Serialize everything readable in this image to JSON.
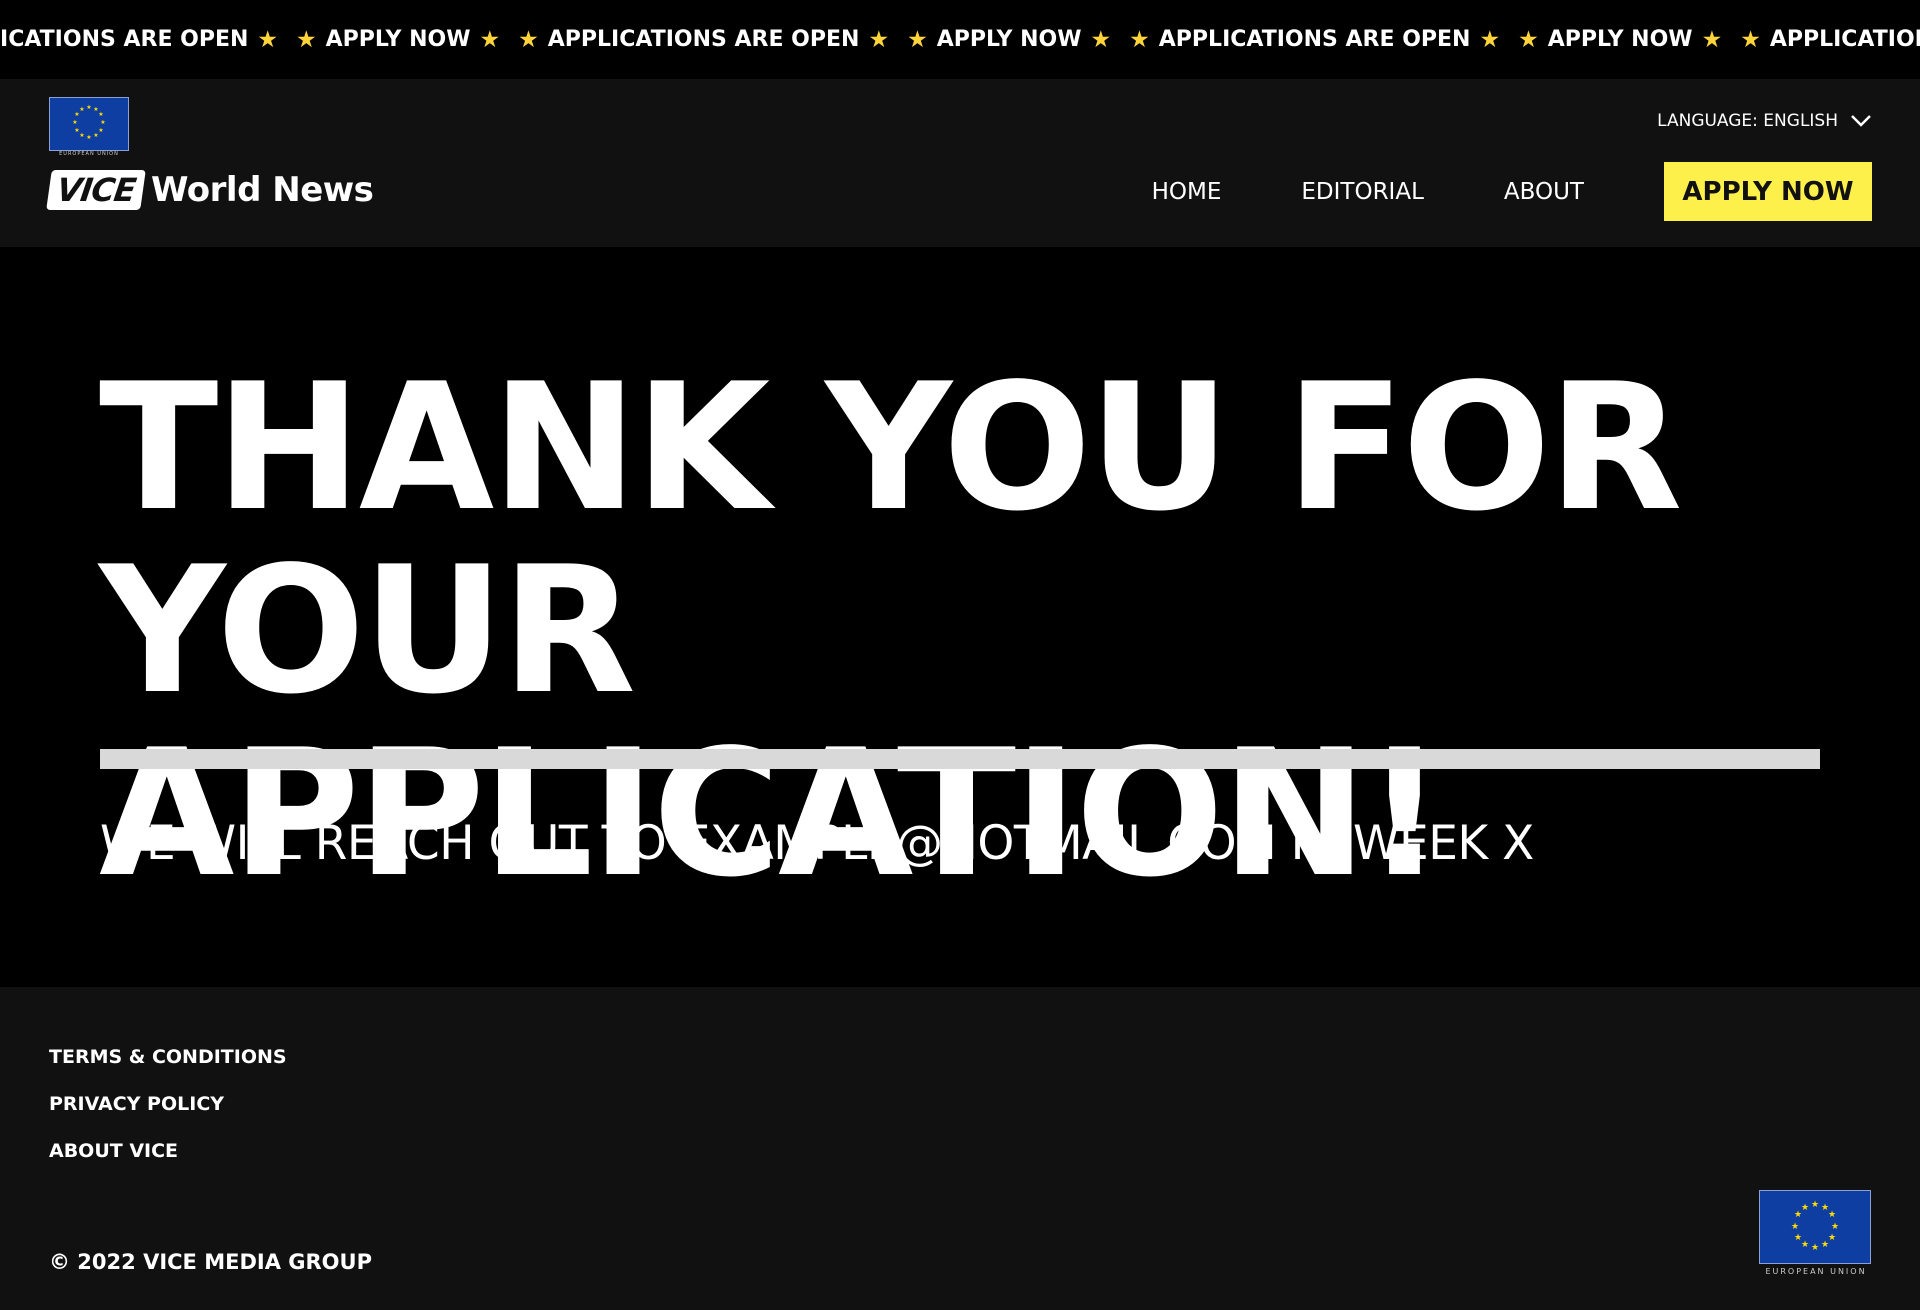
{
  "ticker": {
    "items": [
      {
        "text": "LICATIONS ARE OPEN"
      },
      {
        "text": "APPLY NOW"
      },
      {
        "text": "APPLICATIONS ARE OPEN"
      },
      {
        "text": "APPLY NOW"
      },
      {
        "text": "APPLICATIONS ARE OPEN"
      },
      {
        "text": "APPLY NOW"
      },
      {
        "text": "APPLICATIONS ARE OPEN"
      }
    ],
    "star_color": "#ffd43b"
  },
  "header": {
    "eu_caption": "EUROPEAN UNION",
    "logo_vice": "VICE",
    "logo_text": "World News",
    "language_label": "LANGUAGE: ENGLISH",
    "nav": {
      "home": "HOME",
      "editorial": "EDITORIAL",
      "about": "ABOUT"
    },
    "apply_label": "APPLY NOW",
    "apply_color": "#fdf04a"
  },
  "hero": {
    "headline_line1": "THANK YOU FOR",
    "headline_line2": "YOUR APPLICATION!",
    "subline": "WE WILL REACH OUT TO EXAMPLE@HOTMAIL.COM IN WEEK X"
  },
  "footer": {
    "links": {
      "terms": "TERMS & CONDITIONS",
      "privacy": "PRIVACY POLICY",
      "about_vice": "ABOUT VICE"
    },
    "copyright": "© 2022 VICE MEDIA GROUP",
    "eu_caption": "EUROPEAN UNION"
  },
  "icons": {
    "star": "star-icon",
    "chevron": "chevron-down-icon",
    "eu_flag": "eu-flag-icon"
  },
  "colors": {
    "eu_blue": "#0f3ea3",
    "eu_star": "#ffdd00",
    "header_bg": "#111111",
    "page_bg": "#000000"
  }
}
